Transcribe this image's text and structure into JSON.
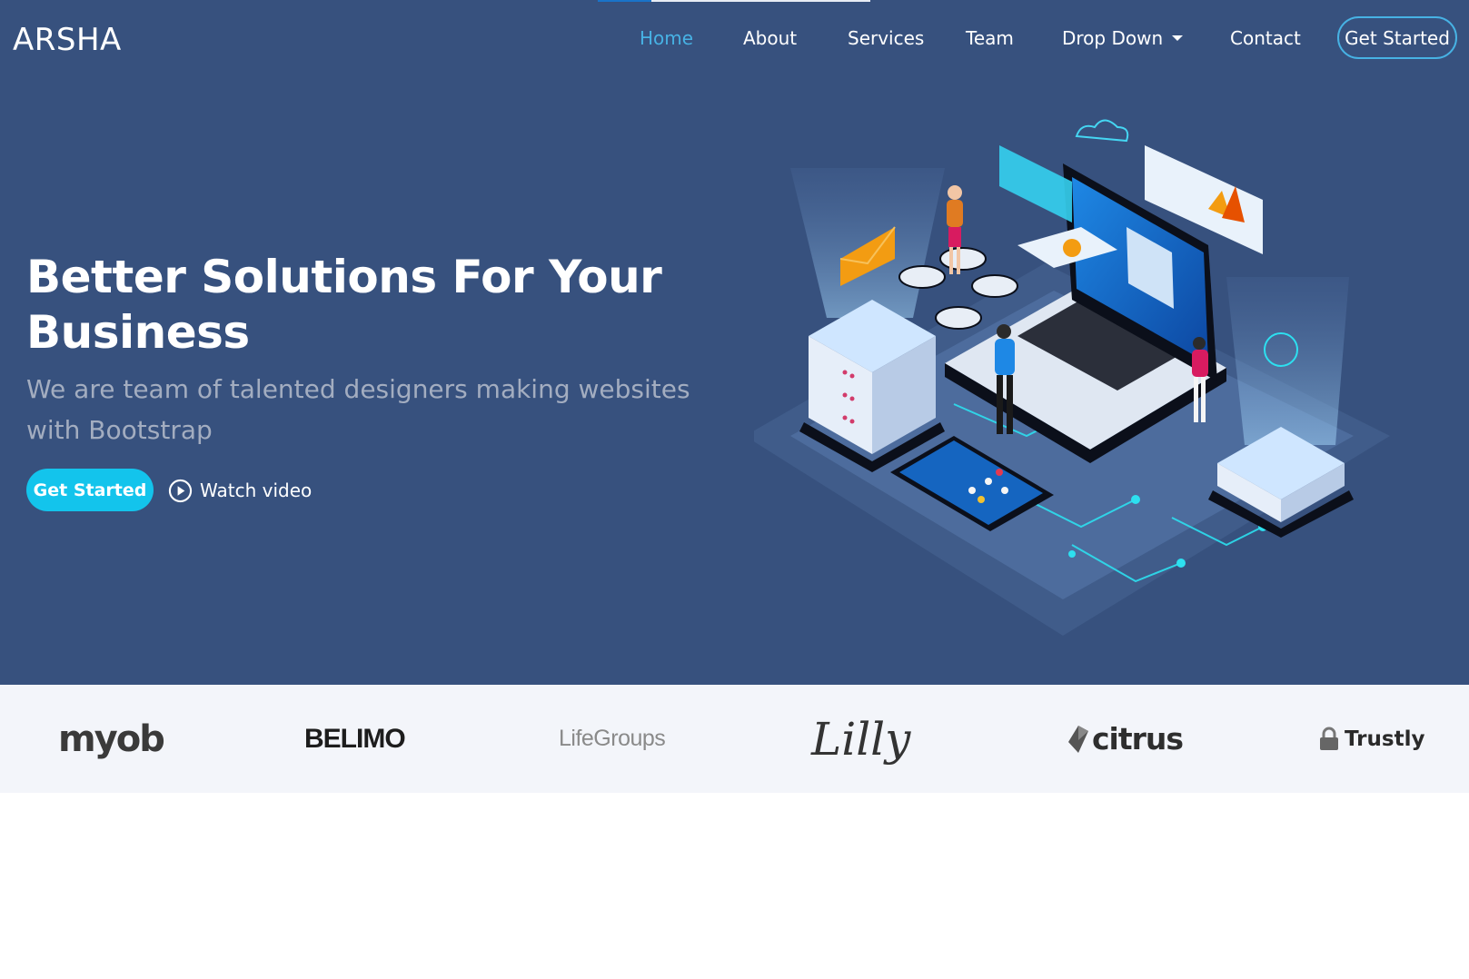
{
  "brand": {
    "name": "ARSHA"
  },
  "nav": {
    "items": [
      {
        "label": "Home",
        "active": true
      },
      {
        "label": "About"
      },
      {
        "label": "Services"
      },
      {
        "label": "Team"
      },
      {
        "label": "Drop Down",
        "has_dropdown": true
      },
      {
        "label": "Contact"
      }
    ],
    "cta": "Get Started"
  },
  "hero": {
    "headline": "Better Solutions For Your Business",
    "subheadline": "We are team of talented designers making websites with Bootstrap",
    "cta_primary": "Get Started",
    "cta_secondary": "Watch video",
    "illustration_icon": "isometric-tech-illustration"
  },
  "clients": {
    "logos": [
      {
        "name": "myob"
      },
      {
        "name": "BELIMO"
      },
      {
        "name": "LifeGroups"
      },
      {
        "name": "Lilly"
      },
      {
        "name": "citrus"
      },
      {
        "name": "Trustly"
      }
    ]
  },
  "colors": {
    "hero_bg": "#37517e",
    "accent": "#47b2e4",
    "primary_button": "#13c4ec",
    "clients_bg": "#f3f5fa"
  }
}
